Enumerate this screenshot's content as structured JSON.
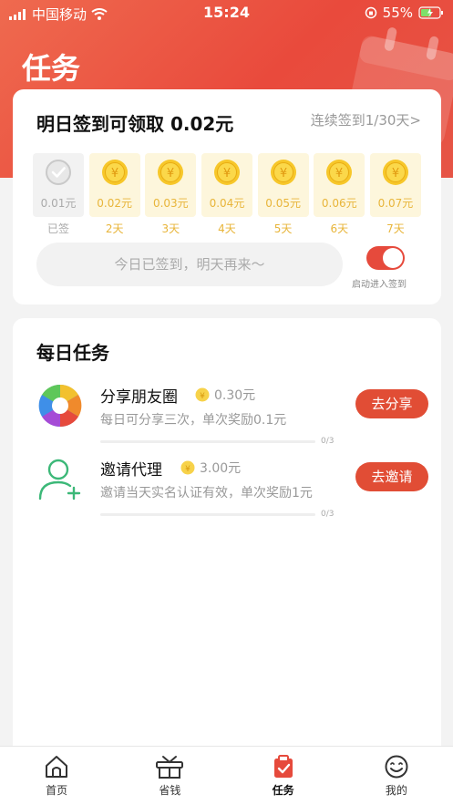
{
  "status_bar": {
    "carrier": "中国移动",
    "time": "15:24",
    "battery": "55%"
  },
  "page": {
    "title": "任务"
  },
  "checkin": {
    "title": "明日签到可领取 0.02元",
    "streak": "连续签到1/30天>",
    "days": [
      {
        "amount": "0.01元",
        "label": "已签",
        "done": true
      },
      {
        "amount": "0.02元",
        "label": "2天",
        "done": false
      },
      {
        "amount": "0.03元",
        "label": "3天",
        "done": false
      },
      {
        "amount": "0.04元",
        "label": "4天",
        "done": false
      },
      {
        "amount": "0.05元",
        "label": "5天",
        "done": false
      },
      {
        "amount": "0.06元",
        "label": "6天",
        "done": false
      },
      {
        "amount": "0.07元",
        "label": "7天",
        "done": false
      }
    ],
    "signed_text": "今日已签到，明天再来～",
    "toggle_label": "启动进入签到",
    "toggle_on": true
  },
  "daily": {
    "title": "每日任务",
    "tasks": [
      {
        "name": "分享朋友圈",
        "reward": "0.30元",
        "desc": "每日可分享三次，单次奖励0.1元",
        "progress": "0/3",
        "progress_fraction": 0,
        "button": "去分享",
        "icon": "camera-aperture-icon"
      },
      {
        "name": "邀请代理",
        "reward": "3.00元",
        "desc": "邀请当天实名认证有效，单次奖励1元",
        "progress": "0/3",
        "progress_fraction": 0,
        "button": "去邀请",
        "icon": "add-user-icon"
      }
    ]
  },
  "tabbar": {
    "tabs": [
      {
        "label": "首页",
        "icon": "home-icon"
      },
      {
        "label": "省钱",
        "icon": "gift-tv-icon"
      },
      {
        "label": "任务",
        "icon": "clipboard-icon",
        "active": true
      },
      {
        "label": "我的",
        "icon": "smiley-icon"
      }
    ]
  },
  "colors": {
    "accent": "#e64a3c",
    "coin": "#f5c518",
    "coin_bg": "#fdf6dc"
  }
}
